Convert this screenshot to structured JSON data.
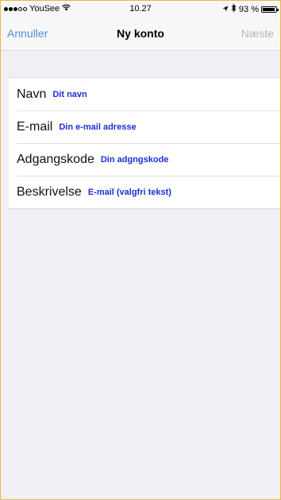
{
  "status_bar": {
    "carrier": "YouSee",
    "time": "10.27",
    "battery_text": "93 %",
    "battery_level": 0.93
  },
  "nav": {
    "cancel_label": "Annuller",
    "title": "Ny konto",
    "next_label": "Næste"
  },
  "form": {
    "rows": [
      {
        "label": "Navn",
        "placeholder": "Dit navn"
      },
      {
        "label": "E-mail",
        "placeholder": "Din e-mail adresse"
      },
      {
        "label": "Adgangskode",
        "placeholder": "Din adgngskode"
      },
      {
        "label": "Beskrivelse",
        "placeholder": "E-mail (valgfri tekst)"
      }
    ]
  },
  "colors": {
    "accent": "#4a90d9",
    "disabled": "#b7b7bc",
    "placeholder": "#1a2fd6",
    "frame_border": "#f0b347",
    "background": "#efeff4"
  }
}
